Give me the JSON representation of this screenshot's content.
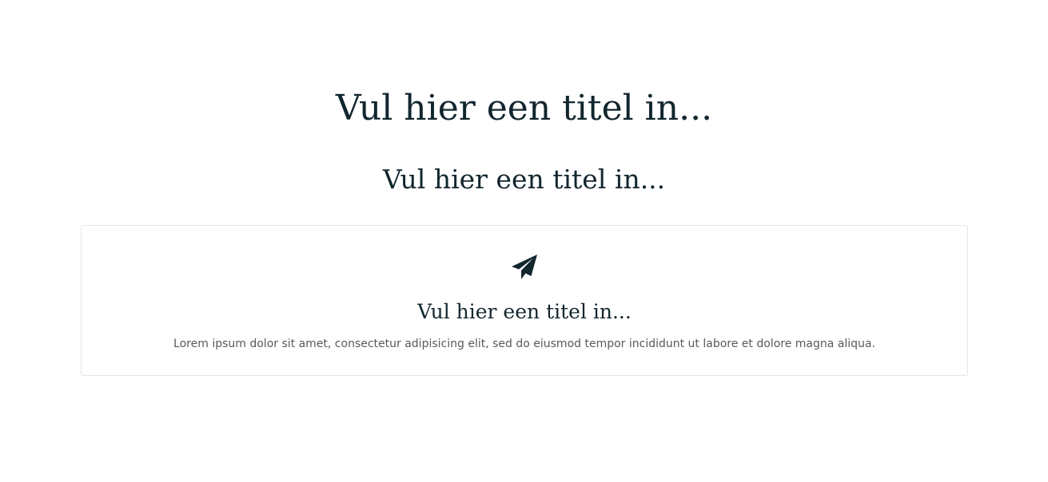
{
  "hero": {
    "title": "Vul hier een titel in...",
    "subtitle": "Vul hier een titel in..."
  },
  "card": {
    "icon": "paper-plane-icon",
    "title": "Vul hier een titel in...",
    "text": "Lorem ipsum dolor sit amet, consectetur adipisicing elit, sed do eiusmod tempor incididunt ut labore et dolore magna aliqua."
  },
  "colors": {
    "text_dark": "#12262e",
    "text_body": "#555a5d",
    "border": "#e3e6e8",
    "background": "#ffffff"
  }
}
